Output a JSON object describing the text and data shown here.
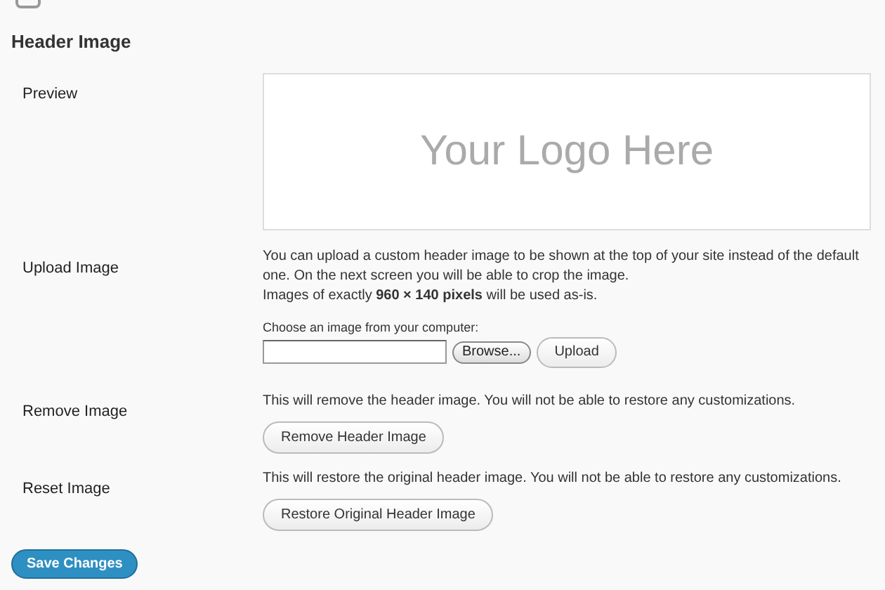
{
  "page": {
    "heading": "Header Image"
  },
  "rows": [
    {
      "kind": "preview",
      "label": "Preview",
      "logo_text": "Your Logo Here"
    },
    {
      "kind": "upload",
      "label": "Upload Image",
      "description": "You can upload a custom header image to be shown at the top of your site instead of the default one. On the next screen you will be able to crop the image.",
      "note": "Images of exactly **960 × 140 pixels** will be used as-is.",
      "field_label": "Choose an image from your computer:",
      "browse_button": "Browse...",
      "upload_button": "Upload"
    },
    {
      "kind": "action",
      "label": "Remove Image",
      "description": "This will remove the header image. You will not be able to restore any customizations.",
      "button": "Remove Header Image"
    },
    {
      "kind": "action",
      "label": "Reset Image",
      "description": "This will restore the original header image. You will not be able to restore any customizations.",
      "button": "Restore Original Header Image"
    }
  ],
  "save_button": "Save Changes"
}
